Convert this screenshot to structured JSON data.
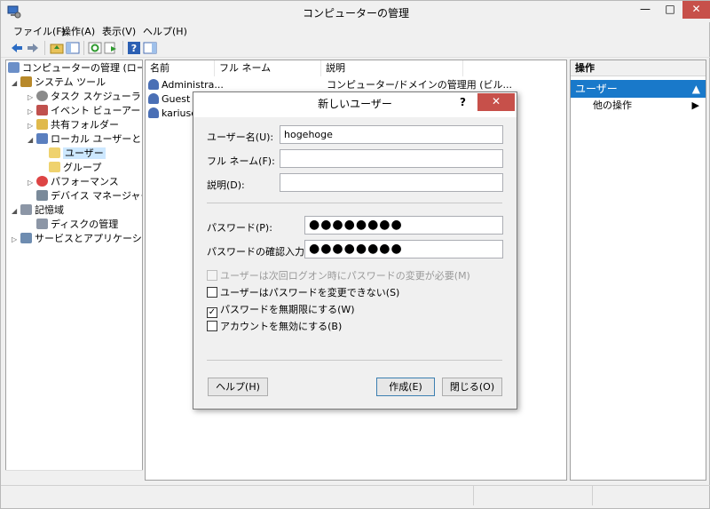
{
  "window": {
    "title": "コンピューターの管理",
    "minimize": "—",
    "maximize": "□",
    "close": "✕"
  },
  "menu": [
    "ファイル(F)",
    "操作(A)",
    "表示(V)",
    "ヘルプ(H)"
  ],
  "tree": {
    "root": "コンピューターの管理 (ローカル)",
    "system_tools": "システム ツール",
    "task_scheduler": "タスク スケジューラ",
    "event_viewer": "イベント ビューアー",
    "shared_folders": "共有フォルダー",
    "local_users_groups": "ローカル ユーザーとグループ",
    "users": "ユーザー",
    "groups": "グループ",
    "performance": "パフォーマンス",
    "device_manager": "デバイス マネージャー",
    "storage": "記憶域",
    "disk_management": "ディスクの管理",
    "services_apps": "サービスとアプリケーション"
  },
  "list": {
    "columns": [
      "名前",
      "フル ネーム",
      "説明"
    ],
    "rows": [
      {
        "name": "Administra...",
        "full_name": "",
        "description": "コンピューター/ドメインの管理用 (ビル..."
      },
      {
        "name": "Guest",
        "full_name": "",
        "description": ""
      },
      {
        "name": "kariuser",
        "full_name": "",
        "description": ""
      }
    ]
  },
  "actions": {
    "header": "操作",
    "selected": "ユーザー",
    "other": "他の操作",
    "collapse_arrow": "▲",
    "more_arrow": "▶"
  },
  "dialog": {
    "title": "新しいユーザー",
    "help_symbol": "?",
    "close_symbol": "✕",
    "username_label": "ユーザー名(U):",
    "username_value": "hogehoge",
    "fullname_label": "フル ネーム(F):",
    "fullname_value": "",
    "description_label": "説明(D):",
    "description_value": "",
    "password_label": "パスワード(P):",
    "password_value": "●●●●●●●●",
    "confirm_label": "パスワードの確認入力(C):",
    "confirm_value": "●●●●●●●●",
    "checkbox_must_change": "ユーザーは次回ログオン時にパスワードの変更が必要(M)",
    "checkbox_cannot_change": "ユーザーはパスワードを変更できない(S)",
    "checkbox_never_expires": "パスワードを無期限にする(W)",
    "checkbox_disabled": "アカウントを無効にする(B)",
    "check_mark": "✓",
    "checked": {
      "must_change": false,
      "cannot_change": false,
      "never_expires": true,
      "disabled": false
    },
    "help_button": "ヘルプ(H)",
    "create_button": "作成(E)",
    "close_button": "閉じる(O)"
  }
}
